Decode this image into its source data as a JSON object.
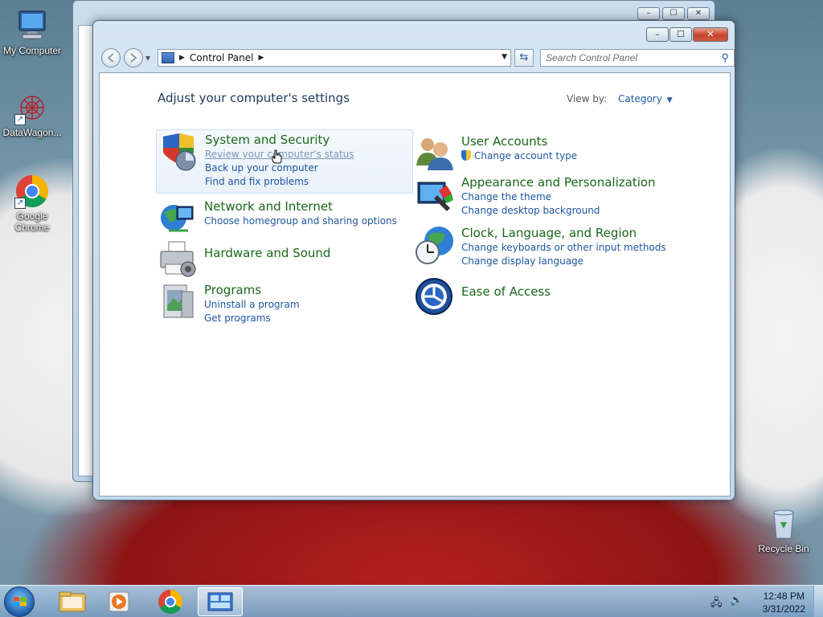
{
  "desktop": {
    "icons": [
      {
        "label": "My Computer"
      },
      {
        "label": "DataWagon..."
      },
      {
        "label": "Google Chrome"
      },
      {
        "label": "Recycle Bin"
      }
    ]
  },
  "window": {
    "controls": {
      "minimize": "–",
      "maximize": "☐",
      "close": "✕"
    },
    "address": {
      "crumb": "Control Panel"
    },
    "search": {
      "placeholder": "Search Control Panel"
    },
    "title": "Adjust your computer's settings",
    "view_by": {
      "label": "View by:",
      "value": "Category"
    },
    "categories_left": [
      {
        "title": "System and Security",
        "links": [
          "Review your computer's status",
          "Back up your computer",
          "Find and fix problems"
        ]
      },
      {
        "title": "Network and Internet",
        "links": [
          "Choose homegroup and sharing options"
        ]
      },
      {
        "title": "Hardware and Sound",
        "links": []
      },
      {
        "title": "Programs",
        "links": [
          "Uninstall a program",
          "Get programs"
        ]
      }
    ],
    "categories_right": [
      {
        "title": "User Accounts",
        "links": [
          "Change account type"
        ]
      },
      {
        "title": "Appearance and Personalization",
        "links": [
          "Change the theme",
          "Change desktop background"
        ]
      },
      {
        "title": "Clock, Language, and Region",
        "links": [
          "Change keyboards or other input methods",
          "Change display language"
        ]
      },
      {
        "title": "Ease of Access",
        "links": []
      }
    ]
  },
  "taskbar": {
    "clock": {
      "time": "12:48 PM",
      "date": "3/31/2022"
    }
  }
}
